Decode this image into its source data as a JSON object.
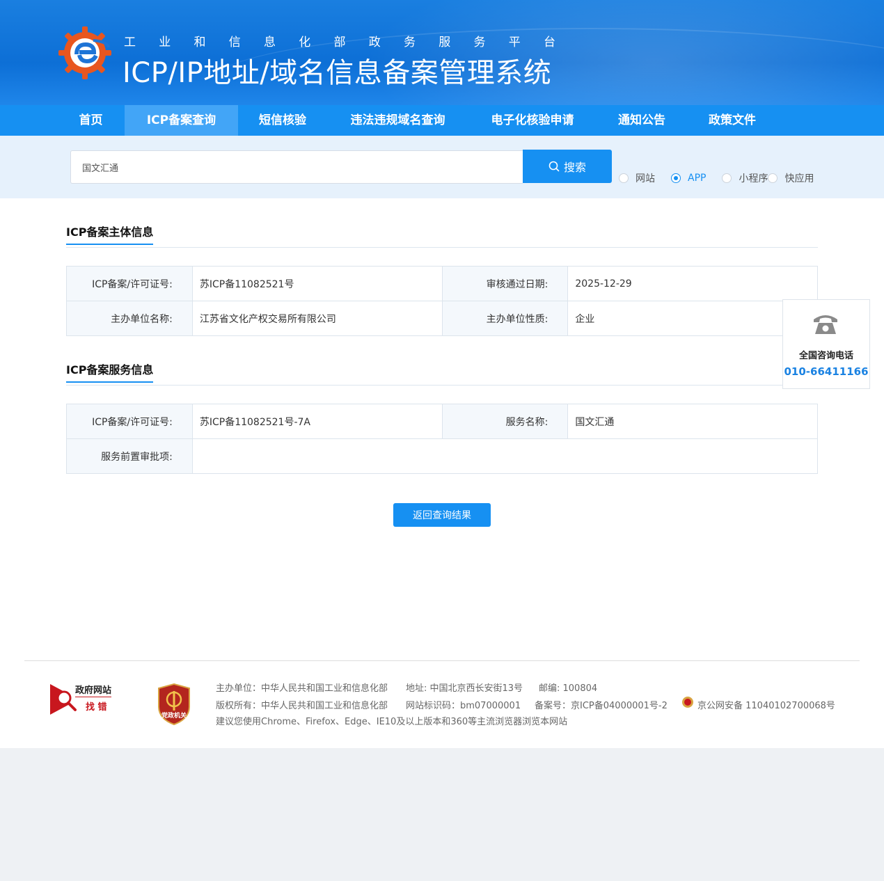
{
  "header": {
    "subtitle_chars": [
      "工",
      "业",
      "和",
      "信",
      "息",
      "化",
      "部",
      "政",
      "务",
      "服",
      "务",
      "平",
      "台"
    ],
    "title": "ICP/IP地址/域名信息备案管理系统"
  },
  "nav": {
    "items": [
      {
        "label": "首页"
      },
      {
        "label": "ICP备案查询"
      },
      {
        "label": "短信核验"
      },
      {
        "label": "违法违规域名查询"
      },
      {
        "label": "电子化核验申请"
      },
      {
        "label": "通知公告"
      },
      {
        "label": "政策文件"
      }
    ],
    "active_index": 1
  },
  "search": {
    "value": "国文汇通",
    "button_label": "搜索",
    "options": [
      "网站",
      "APP",
      "小程序",
      "快应用"
    ],
    "selected": "APP"
  },
  "subject_section": {
    "title": "ICP备案主体信息",
    "rows": [
      [
        {
          "k": "ICP备案/许可证号:",
          "v": "苏ICP备11082521号"
        },
        {
          "k": "审核通过日期:",
          "v": "2025-12-29"
        }
      ],
      [
        {
          "k": "主办单位名称:",
          "v": "江苏省文化产权交易所有限公司"
        },
        {
          "k": "主办单位性质:",
          "v": "企业"
        }
      ]
    ]
  },
  "service_section": {
    "title": "ICP备案服务信息",
    "license_label": "ICP备案/许可证号:",
    "license_value": "苏ICP备11082521号-7A",
    "service_name_label": "服务名称:",
    "service_name_value": "国文汇通",
    "pre_approval_label": "服务前置审批项:",
    "pre_approval_value": ""
  },
  "back_button": "返回查询结果",
  "consult": {
    "label": "全国咨询电话",
    "number": "010-66411166"
  },
  "footer": {
    "logo1_top": "政府网站",
    "logo1_bottom": "找 错",
    "logo2_text": "党政机关",
    "line1": [
      "主办单位：中华人民共和国工业和信息化部",
      "地址: 中国北京西长安街13号",
      "邮编: 100804"
    ],
    "line2": [
      "版权所有：中华人民共和国工业和信息化部",
      "网站标识码：bm07000001",
      "备案号：京ICP备04000001号-2",
      "京公网安备 11040102700068号"
    ],
    "line3": "建议您使用Chrome、Firefox、Edge、IE10及以上版本和360等主流浏览器浏览本网站"
  },
  "colors": {
    "primary": "#1690f2",
    "nav_active": "#42a5f7",
    "header_bg": "#0d6fd6",
    "phone_number": "#1a82e2"
  }
}
